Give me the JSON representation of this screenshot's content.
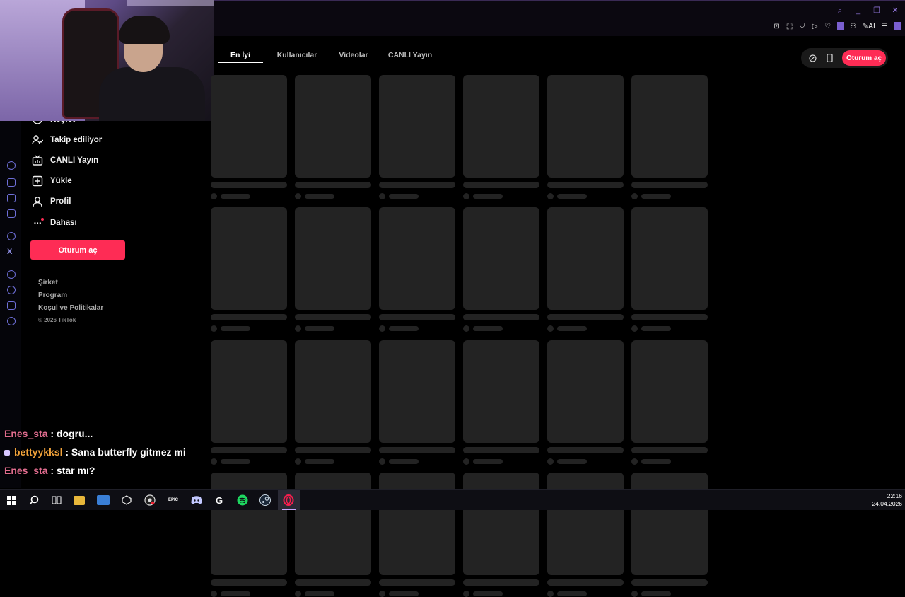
{
  "window": {
    "controls": [
      "search-icon",
      "minimize-icon",
      "restore-icon",
      "close-icon"
    ],
    "extensions": [
      "pin-icon",
      "screenshot-icon",
      "shield-icon",
      "play-icon",
      "heart-icon",
      "account-icon",
      "ai-icon",
      "menu-icon"
    ],
    "ai_label": "AI"
  },
  "sidebar": {
    "items": [
      {
        "label": "Keşfet",
        "icon": "compass-icon"
      },
      {
        "label": "Takip ediliyor",
        "icon": "following-icon"
      },
      {
        "label": "CANLI Yayın",
        "icon": "live-icon"
      },
      {
        "label": "Yükle",
        "icon": "upload-icon"
      },
      {
        "label": "Profil",
        "icon": "profile-icon"
      },
      {
        "label": "Dahası",
        "icon": "more-icon"
      }
    ],
    "login_label": "Oturum aç",
    "footer_links": [
      "Şirket",
      "Program",
      "Koşul ve Politikalar"
    ],
    "copyright": "© 2026 TikTok"
  },
  "tabs": {
    "items": [
      "En İyi",
      "Kullanıcılar",
      "Videolar",
      "CANLI Yayın"
    ],
    "active": "En İyi"
  },
  "header": {
    "login_label": "Oturum aç",
    "icons": [
      "coin-icon",
      "phone-icon"
    ]
  },
  "chat": {
    "messages": [
      {
        "user": "Enes_sta",
        "text": " : dogru...",
        "color": "#e06c8e"
      },
      {
        "user": "bettyykksl",
        "text": " : Sana butterfly gitmez mi",
        "color": "#f2a33a"
      },
      {
        "user": "Enes_sta",
        "text": " : star mı?",
        "color": "#e06c8e"
      }
    ]
  },
  "taskbar": {
    "time": "22:16",
    "date": "24.04.2026",
    "apps": [
      "windows-icon",
      "search-icon",
      "task-view-icon",
      "file-explorer-icon",
      "app-icon",
      "unity-icon",
      "obs-icon",
      "epic-games-icon",
      "discord-icon",
      "g-app-icon",
      "spotify-icon",
      "steam-icon",
      "opera-gx-icon"
    ]
  },
  "colors": {
    "accent": "#fe2c55",
    "skeleton": "#232323",
    "background": "#000000"
  }
}
